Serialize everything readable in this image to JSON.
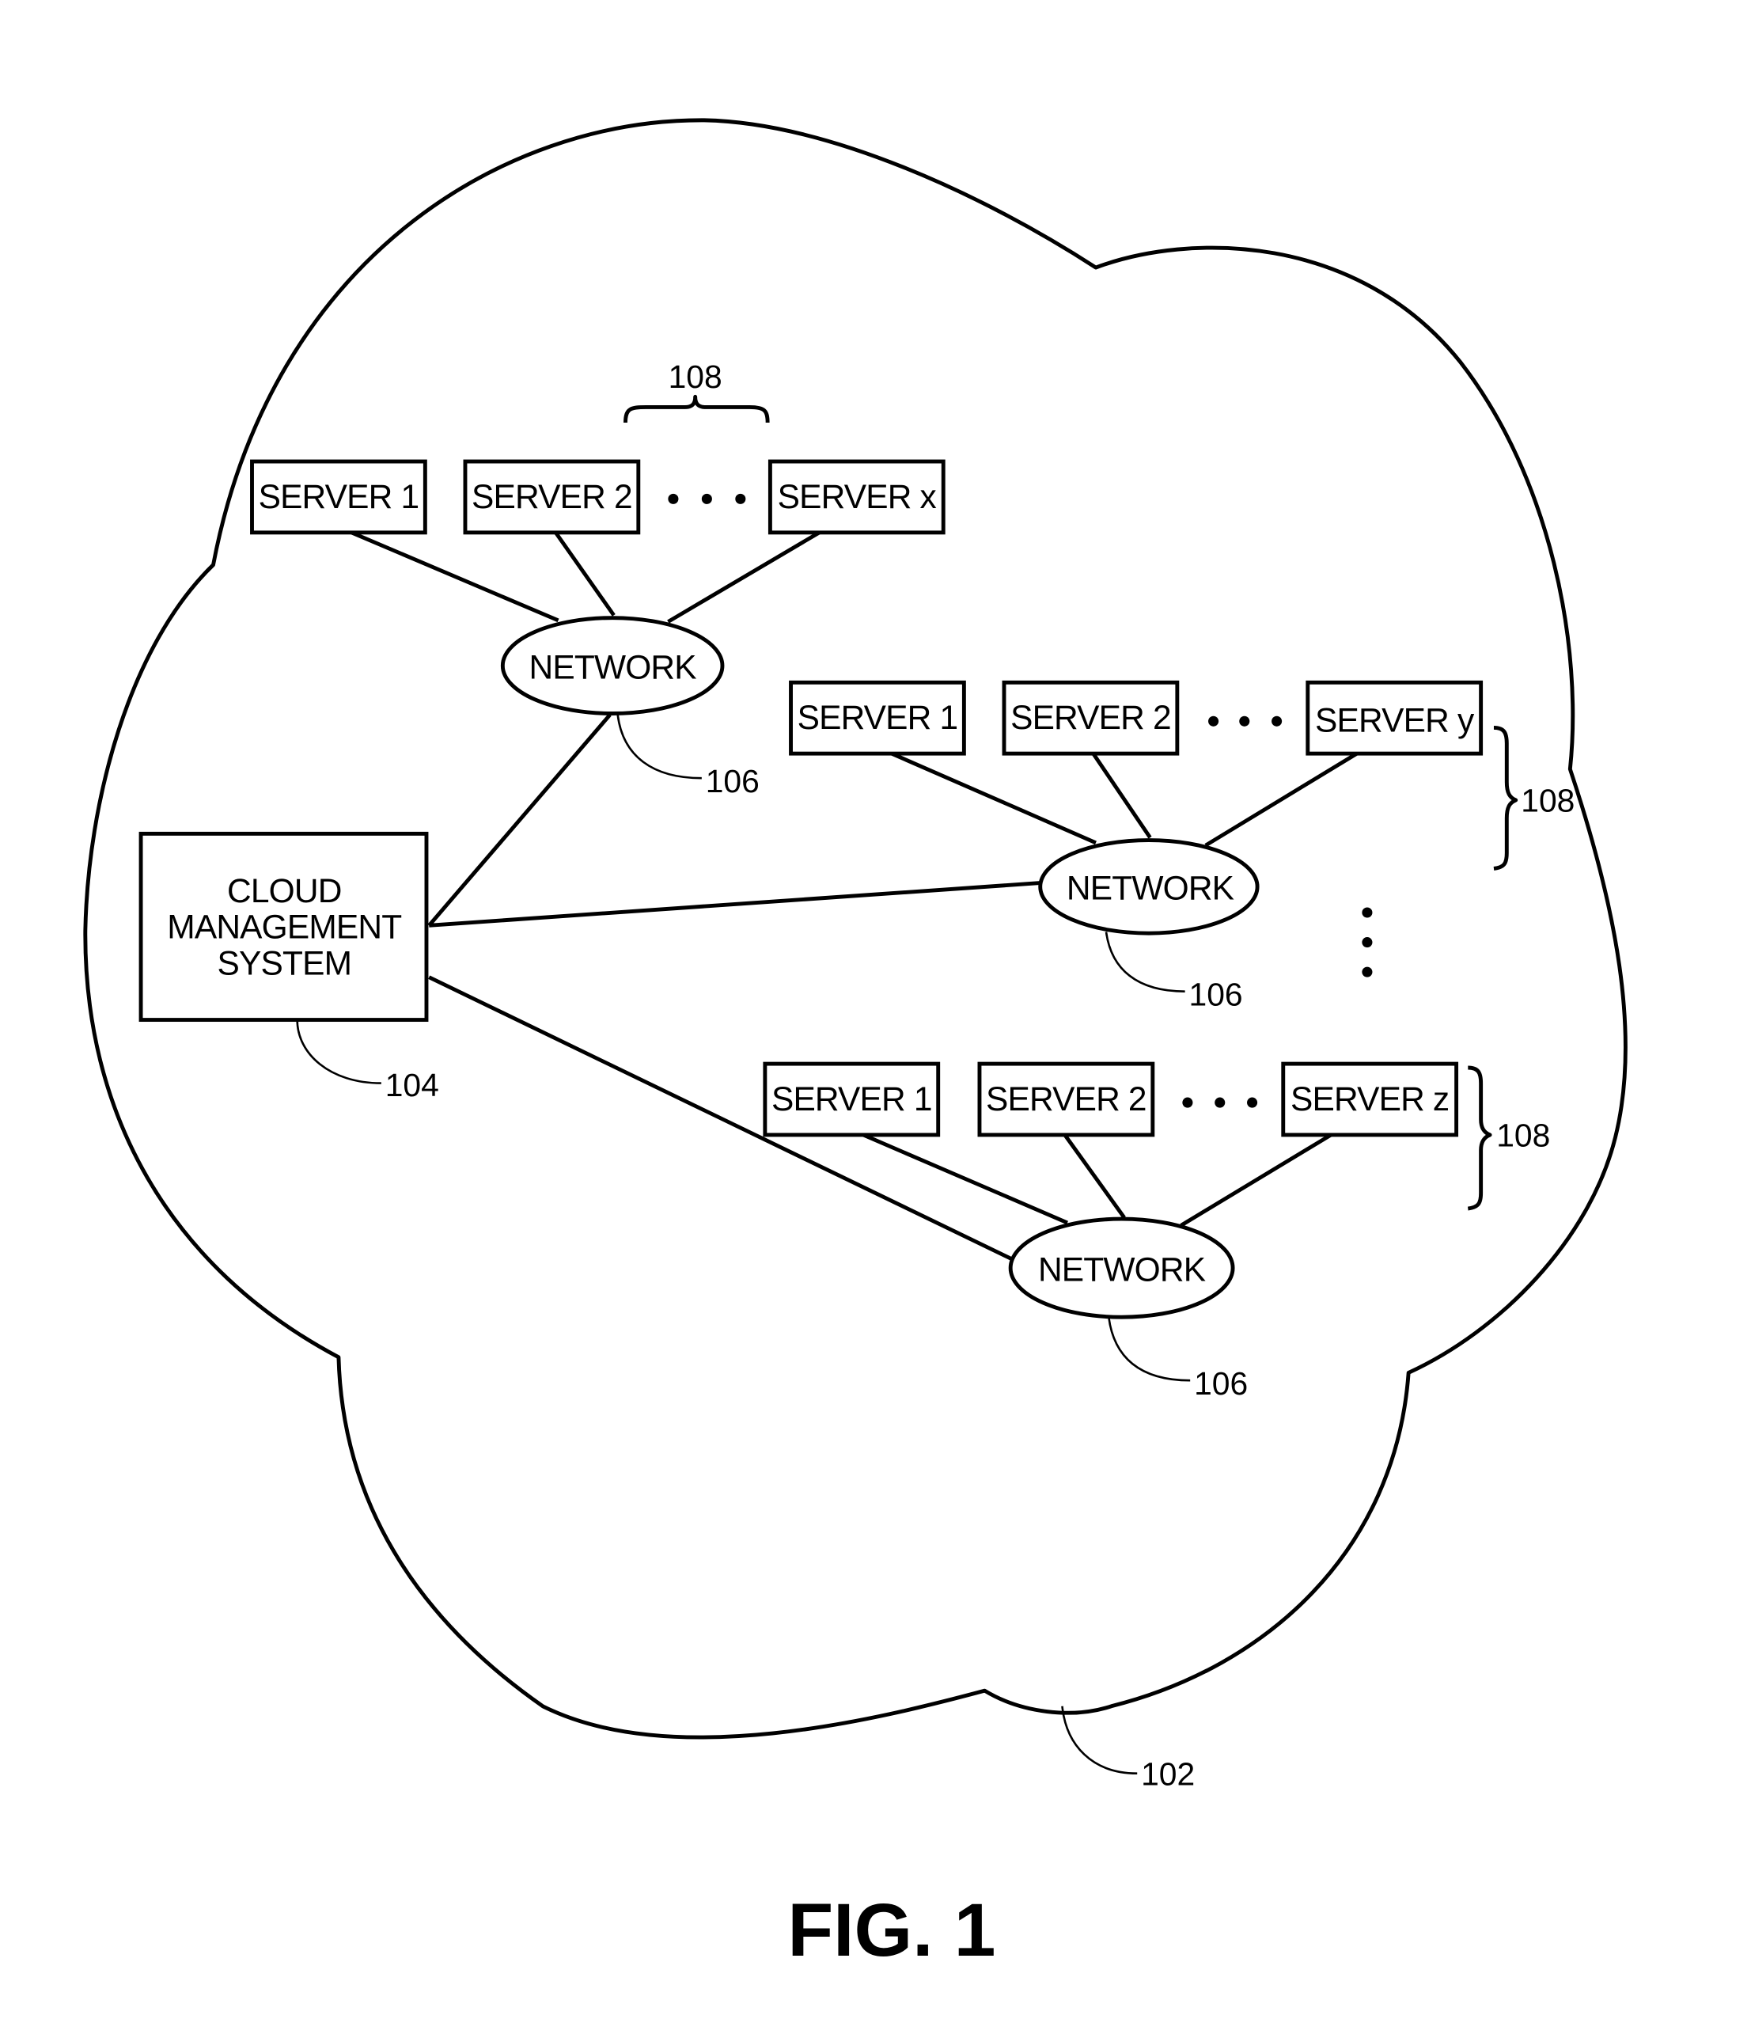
{
  "figure": {
    "caption": "FIG. 1",
    "cloud_ref": "102",
    "cms": {
      "lines": [
        "CLOUD",
        "MANAGEMENT",
        "SYSTEM"
      ],
      "ref": "104"
    },
    "groups": [
      {
        "servers": [
          "SERVER 1",
          "SERVER 2",
          "SERVER x"
        ],
        "network_label": "NETWORK",
        "network_ref": "106",
        "group_ref": "108"
      },
      {
        "servers": [
          "SERVER 1",
          "SERVER 2",
          "SERVER y"
        ],
        "network_label": "NETWORK",
        "network_ref": "106",
        "group_ref": "108"
      },
      {
        "servers": [
          "SERVER 1",
          "SERVER 2",
          "SERVER z"
        ],
        "network_label": "NETWORK",
        "network_ref": "106",
        "group_ref": "108"
      }
    ]
  }
}
